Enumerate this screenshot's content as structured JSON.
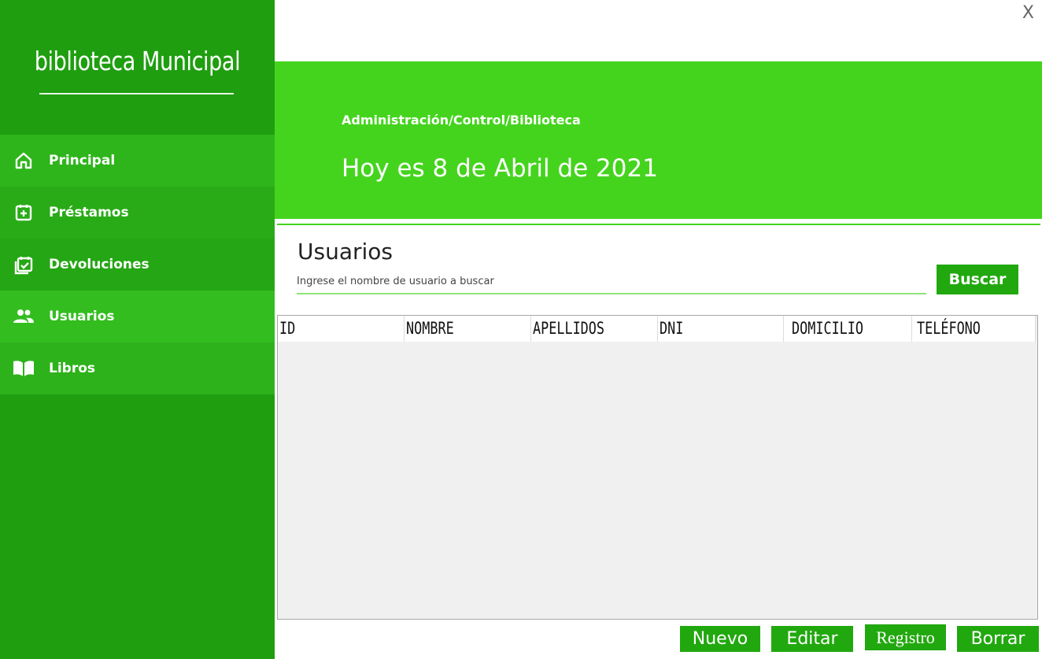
{
  "app": {
    "brand": "biblioteca Municipal",
    "close_label": "X"
  },
  "sidebar": {
    "items": [
      {
        "label": "Principal",
        "icon": "home-icon"
      },
      {
        "label": "Préstamos",
        "icon": "calendar-plus-icon"
      },
      {
        "label": "Devoluciones",
        "icon": "calendar-check-icon"
      },
      {
        "label": "Usuarios",
        "icon": "users-icon"
      },
      {
        "label": "Libros",
        "icon": "book-icon"
      }
    ]
  },
  "header": {
    "breadcrumb": "Administración/Control/Biblioteca",
    "date_text": "Hoy es 8 de Abril de 2021"
  },
  "main": {
    "title": "Usuarios",
    "search": {
      "placeholder": "Ingrese el nombre de usuario a buscar",
      "value": ""
    },
    "search_button": "Buscar",
    "table": {
      "columns": [
        "ID",
        "NOMBRE",
        "APELLIDOS",
        "DNI",
        "DOMICILIO",
        "TELÉFONO"
      ],
      "rows": []
    },
    "actions": {
      "nuevo": "Nuevo",
      "editar": "Editar",
      "registro": "Registro",
      "borrar": "Borrar"
    }
  },
  "colors": {
    "sidebar": "#1f9e10",
    "header": "#45d41e",
    "button": "#22a80f"
  }
}
